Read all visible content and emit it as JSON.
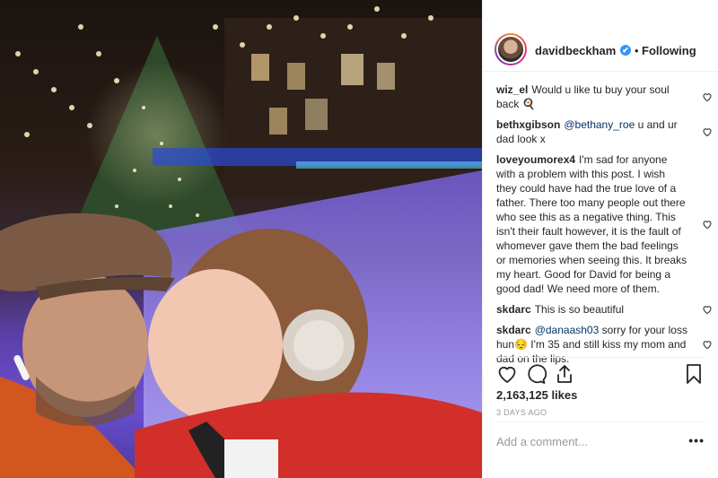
{
  "header": {
    "username": "davidbeckham",
    "verified_glyph": "✔",
    "separator": "•",
    "follow_status": "Following"
  },
  "comments": [
    {
      "user": "wiz_el",
      "pre": "",
      "mention": "",
      "text": "Would u like tu buy your soul back 🍳"
    },
    {
      "user": "bethxgibson",
      "pre": "",
      "mention": "@bethany_roe",
      "text": " u and ur dad look x"
    },
    {
      "user": "loveyoumorex4",
      "pre": "",
      "mention": "",
      "text": "I'm sad for anyone with a problem with this post. I wish they could have had the true love of a father. There too many people out there who see this as a negative thing. This isn't their fault however, it is the fault of whomever gave them the bad feelings or memories when seeing this. It breaks my heart. Good for David for being a good dad! We need more of them."
    },
    {
      "user": "skdarc",
      "pre": "",
      "mention": "",
      "text": "This is so beautiful"
    },
    {
      "user": "skdarc",
      "pre": "",
      "mention": "@danaash03",
      "text": " sorry for your loss hun😔 I'm 35 and still kiss my mom and dad on the lips."
    }
  ],
  "likes": "2,163,125 likes",
  "date": "3 DAYS AGO",
  "add_comment_placeholder": "Add a comment...",
  "more_glyph": "•••",
  "icons": [
    "heart-icon",
    "comment-icon",
    "share-icon",
    "bookmark-icon",
    "more-options-icon"
  ],
  "colors": {
    "verified": "#3897f0",
    "mention": "#003569",
    "muted": "#999999"
  }
}
